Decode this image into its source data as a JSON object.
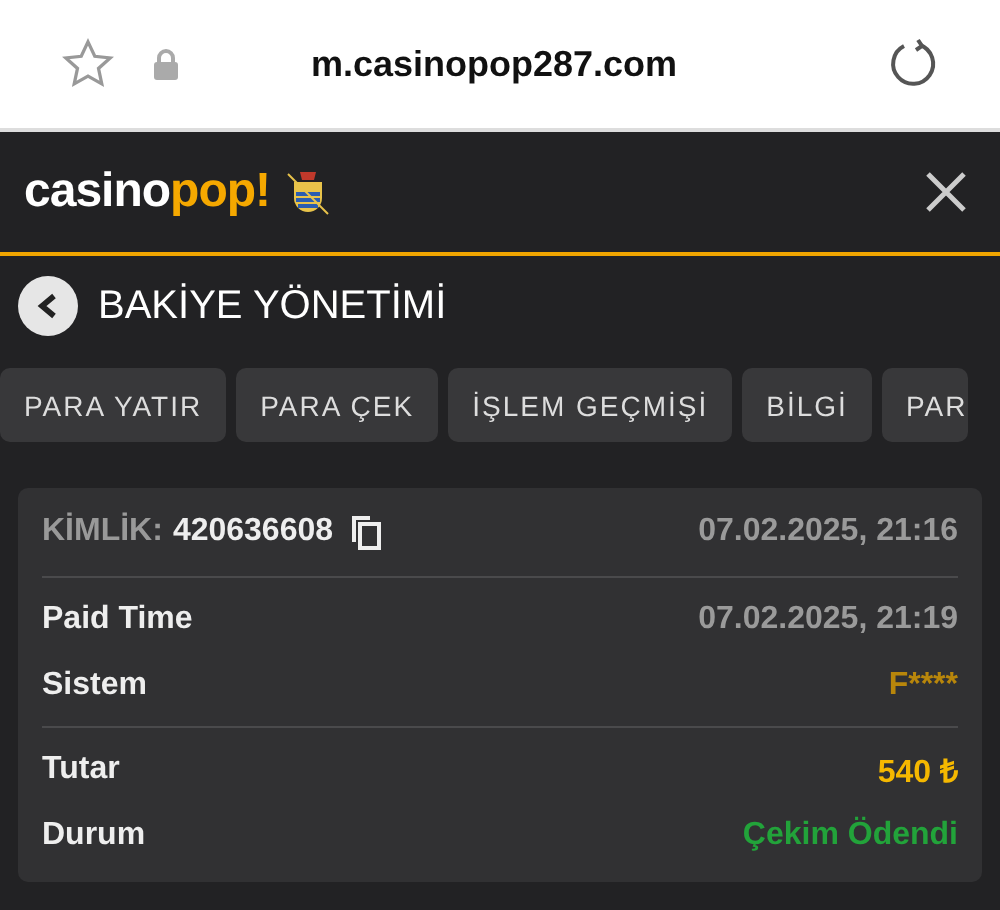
{
  "browser": {
    "url": "m.casinopop287.com"
  },
  "header": {
    "logo": {
      "word": "casino",
      "accent": "pop!"
    }
  },
  "page": {
    "title": "BAKİYE YÖNETİMİ"
  },
  "tabs": [
    {
      "label": "PARA YATIR",
      "selected": false
    },
    {
      "label": "PARA ÇEK",
      "selected": false
    },
    {
      "label": "İŞLEM GEÇMİŞİ",
      "selected": false
    },
    {
      "label": "BİLGİ",
      "selected": false
    },
    {
      "label": "PAR",
      "selected": false
    }
  ],
  "transaction": {
    "id_label": "KİMLİK:",
    "id": "420636608",
    "created": "07.02.2025, 21:16",
    "groups": [
      [
        {
          "label": "Paid Time",
          "value": "07.02.2025, 21:19",
          "color": "#9a9a9a"
        },
        {
          "label": "Sistem",
          "value": "F****",
          "color": "#b8860b"
        }
      ],
      [
        {
          "label": "Tutar",
          "value": "540 ₺",
          "color": "#f5b800"
        },
        {
          "label": "Durum",
          "value": "Çekim Ödendi",
          "color": "#22a33a"
        }
      ]
    ]
  }
}
